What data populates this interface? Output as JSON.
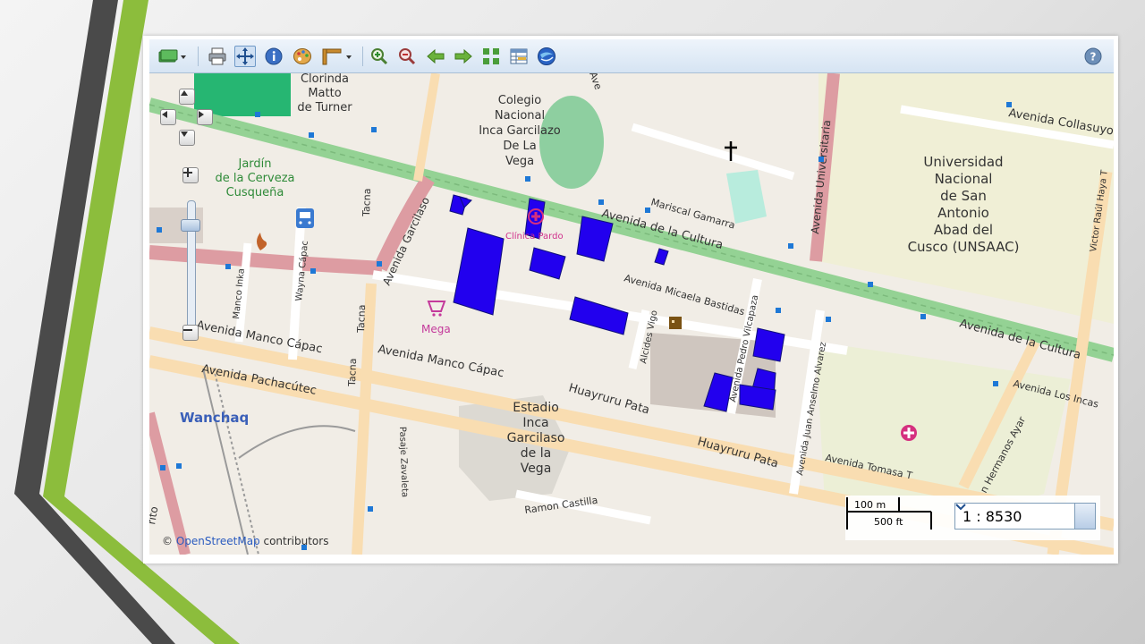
{
  "toolbar": {
    "tools": [
      {
        "name": "layers-icon",
        "has_dropdown": true
      },
      {
        "name": "print-icon"
      },
      {
        "name": "pan-icon",
        "active": true
      },
      {
        "name": "info-icon"
      },
      {
        "name": "palette-icon"
      },
      {
        "name": "measure-icon",
        "has_dropdown": true
      },
      {
        "name": "zoom-in-icon"
      },
      {
        "name": "zoom-out-icon"
      },
      {
        "name": "back-arrow-icon"
      },
      {
        "name": "forward-arrow-icon"
      },
      {
        "name": "full-extent-icon"
      },
      {
        "name": "table-icon"
      },
      {
        "name": "globe-icon"
      }
    ],
    "help_icon": "help-icon"
  },
  "map": {
    "labels": {
      "clorinda": [
        "Clorinda",
        "Matto",
        "de Turner"
      ],
      "colegio": [
        "Colegio",
        "Nacional",
        "Inca Garcilazo",
        "De La",
        "Vega"
      ],
      "universidad": [
        "Universidad",
        "Nacional",
        "de San",
        "Antonio",
        "Abad del",
        "Cusco (UNSAAC)"
      ],
      "jardin": [
        "Jardín",
        "de la Cerveza",
        "Cusqueña"
      ],
      "estadio": [
        "Estadio",
        "Inca",
        "Garcilaso",
        "de la",
        "Vega"
      ],
      "avenida_collasuyo": "Avenida Collasuyo",
      "avenida_universitaria": "Avenida Universitaria",
      "avenida_cultura_1": "Avenida de la Cultura",
      "avenida_cultura_2": "Avenida de la Cultura",
      "mariscal_gamarra": "Mariscal Gamarra",
      "avenida_garcilaso": "Avenida Garcilaso",
      "clinica_pardo": "Clínica Pardo",
      "avenida_micaela": "Avenida Micaela Bastidas",
      "tacna_1": "Tacna",
      "tacna_2": "Tacna",
      "tacna_3": "Tacna",
      "wayna_capac": "Wayna Cápac",
      "manco_inka": "Manco Inka",
      "avenida_manco_capac_1": "Avenida Manco Cápac",
      "avenida_manco_capac_2": "Avenida Manco Cápac",
      "avenida_pachacutec": "Avenida Pachacútec",
      "mega": "Mega",
      "alcides_vigo": "Alcides Vigo",
      "pedro_vilcapaza": "Avenida Pedro Vilcapaza",
      "avenida_alvarez": "Avenida Juan Anselmo Alvarez",
      "huayruru_pata_1": "Huayruru Pata",
      "huayruru_pata_2": "Huayruru Pata",
      "avenida_tomasa": "Avenida Tomasa T",
      "avenida_los_incas": "Avenida Los Incas",
      "hermanos_ayar": "n Hermanos Ayar",
      "victor_raul": "Victor Raúl Haya T",
      "wanchaq": "Wanchaq",
      "pasaje_zavaleta": "Pasaje Zavaleta",
      "ramon_castilla": "Ramon Castilla",
      "ave_top": "Ave",
      "rito": "rito"
    },
    "attribution": {
      "prefix": "© ",
      "link": "OpenStreetMap",
      "suffix": " contributors"
    },
    "scale": {
      "metric": "100 m",
      "imperial": "500 ft",
      "ratio": "1 : 8530"
    }
  },
  "colors": {
    "accent_green": "#8cbd3c",
    "dark_stripe": "#4a4a4a",
    "building_highlight": "#2200ee",
    "primary_road": "#94d294",
    "secondary_road": "#dd9ca2",
    "tertiary_road": "#f9ddb1"
  }
}
